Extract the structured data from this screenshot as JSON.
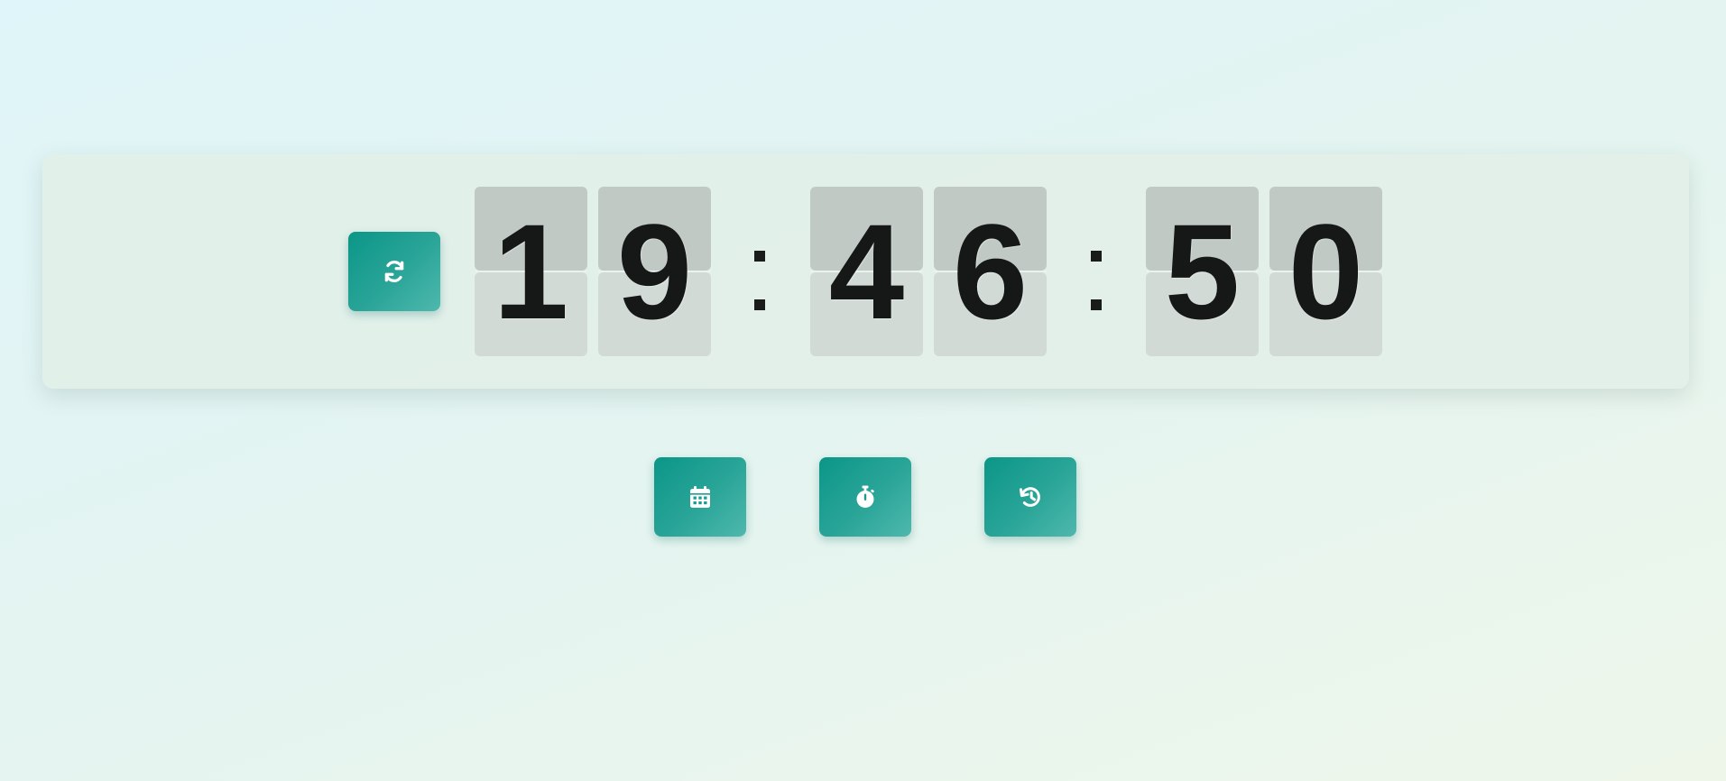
{
  "clock": {
    "hours": [
      "1",
      "9"
    ],
    "minutes": [
      "4",
      "6"
    ],
    "seconds": [
      "5",
      "0"
    ]
  },
  "buttons": {
    "refresh_icon": "refresh-icon",
    "calendar_icon": "calendar-icon",
    "stopwatch_icon": "stopwatch-icon",
    "history_icon": "history-icon"
  },
  "colors": {
    "accent": "#0b9688",
    "accent_light": "#4fb8ad",
    "digit": "#161817",
    "card_top": "#c0c9c4",
    "card_bottom": "#d1dad5"
  }
}
